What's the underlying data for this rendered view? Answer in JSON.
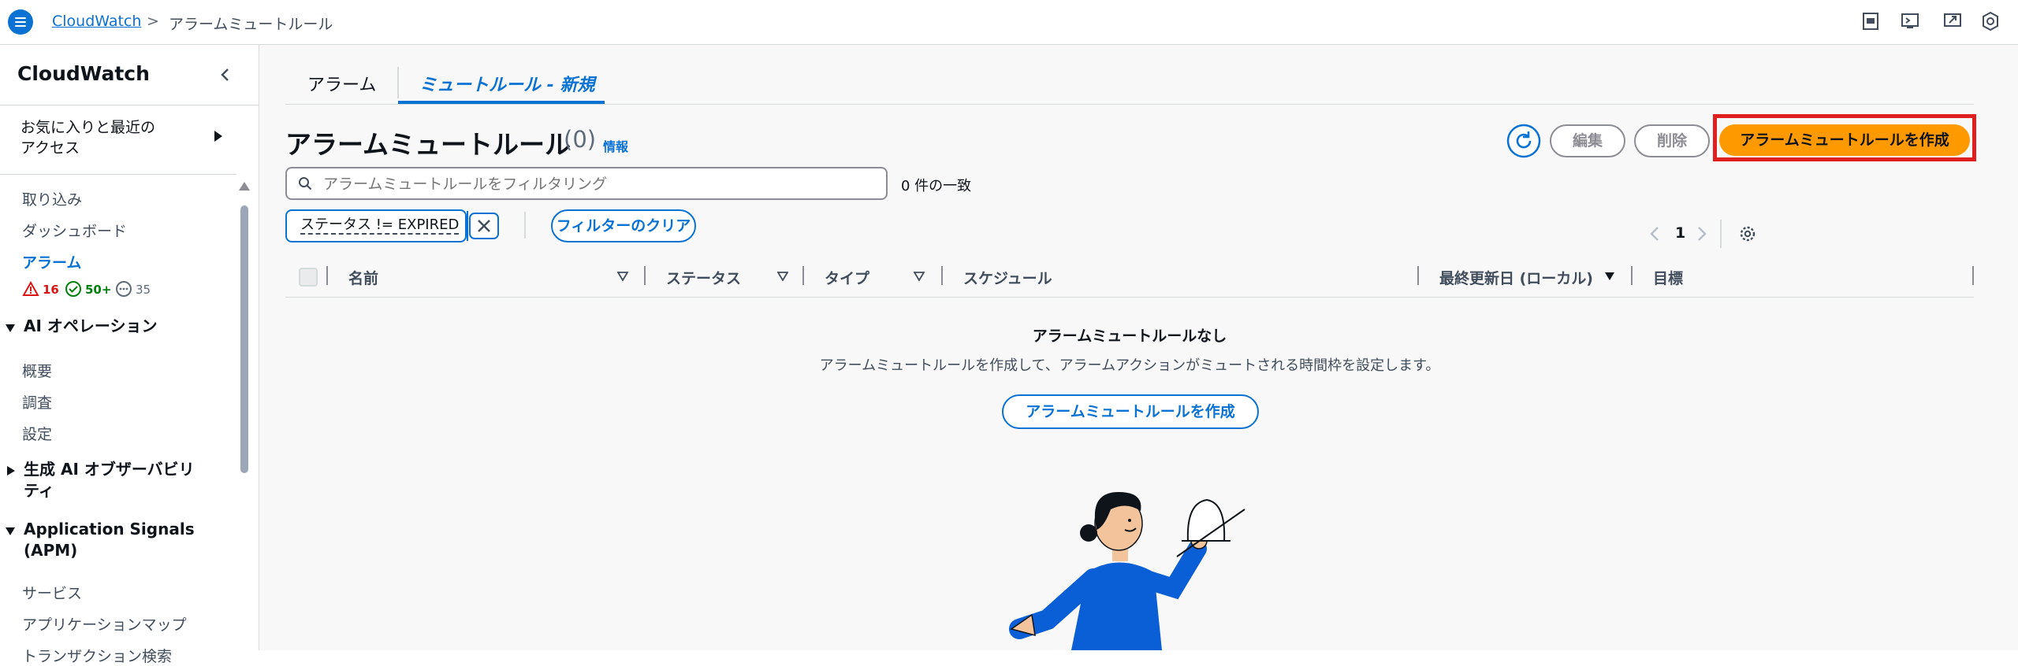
{
  "topbar": {
    "breadcrumb_root": "CloudWatch",
    "breadcrumb_separator": ">",
    "breadcrumb_current": "アラームミュートルール"
  },
  "sidebar": {
    "title": "CloudWatch",
    "favorites": "お気に入りと最近の\nアクセス",
    "items": [
      "取り込み",
      "ダッシュボード"
    ],
    "alarms_label": "アラーム",
    "alarm_badges": {
      "alarm": "16",
      "ok": "50+",
      "insufficient": "35"
    },
    "ai_ops_heading": "AI オペレーション",
    "ai_ops_items": [
      "概要",
      "調査",
      "設定"
    ],
    "genai_heading": "生成 AI オブザーバビリティ",
    "app_signals_heading": "Application Signals (APM)",
    "app_signals_items": [
      "サービス",
      "アプリケーションマップ",
      "トランザクション検索"
    ]
  },
  "tabs": {
    "alarms": "アラーム",
    "mute_rules": "ミュートルール - 新規"
  },
  "header": {
    "title": "アラームミュートルール",
    "count": "(0)",
    "info": "情報",
    "edit": "編集",
    "delete": "削除",
    "create": "アラームミュートルールを作成"
  },
  "filter": {
    "placeholder": "アラームミュートルールをフィルタリング",
    "match_count": "0 件の一致",
    "token": "ステータス != EXPIRED",
    "clear": "フィルターのクリア"
  },
  "pagination": {
    "page": "1"
  },
  "table": {
    "columns": [
      "名前",
      "ステータス",
      "タイプ",
      "スケジュール",
      "最終更新日 (ローカル)",
      "目標"
    ],
    "empty_title": "アラームミュートルールなし",
    "empty_desc": "アラームミュートルールを作成して、アラームアクションがミュートされる時間枠を設定します。",
    "empty_button": "アラームミュートルールを作成"
  },
  "colors": {
    "accent": "#0972d3",
    "primary": "#ff9900",
    "highlight": "#e02020"
  }
}
